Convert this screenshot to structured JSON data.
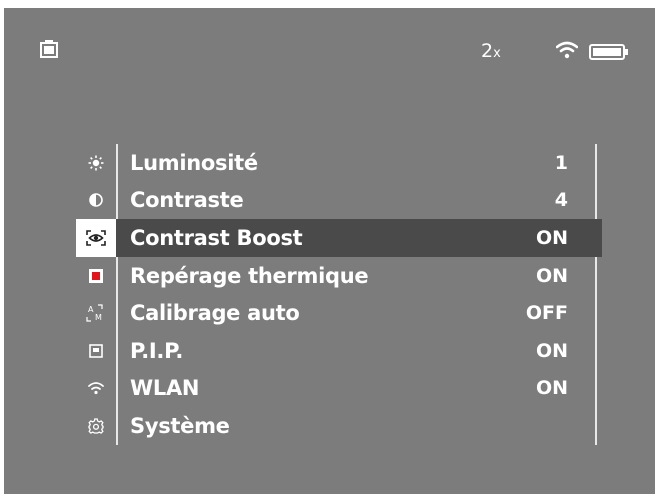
{
  "status": {
    "zoom_number": "2",
    "zoom_suffix": "x"
  },
  "menu": {
    "items": [
      {
        "icon": "brightness-icon",
        "label": "Luminosité",
        "value": "1"
      },
      {
        "icon": "contrast-icon",
        "label": "Contraste",
        "value": "4"
      },
      {
        "icon": "contrast-boost-eye-icon",
        "label": "Contrast Boost",
        "value": "ON",
        "selected": true
      },
      {
        "icon": "thermal-tracking-square-icon",
        "label": "Repérage thermique",
        "value": "ON"
      },
      {
        "icon": "auto-calibration-am-icon",
        "label": "Calibrage auto",
        "value": "OFF"
      },
      {
        "icon": "pip-window-icon",
        "label": "P.I.P.",
        "value": "ON"
      },
      {
        "icon": "wifi-icon",
        "label": "WLAN",
        "value": "ON"
      },
      {
        "icon": "gear-icon",
        "label": "Système",
        "value": ""
      }
    ]
  },
  "colors": {
    "background": "#7c7c7c",
    "selected_row": "#4a4a4a",
    "text": "#ffffff",
    "accent_red": "#e3141b"
  }
}
